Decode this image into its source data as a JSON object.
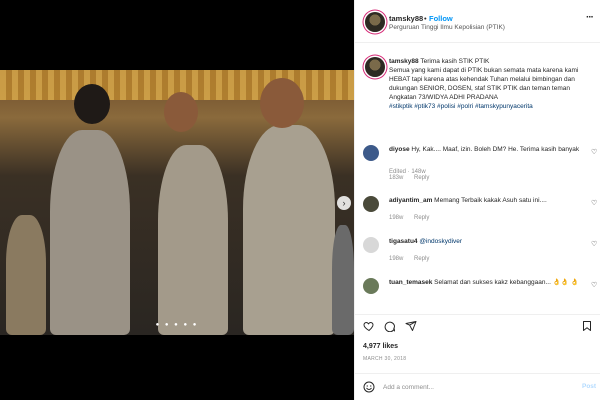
{
  "post": {
    "username": "tamsky88",
    "follow_label": "Follow",
    "dot": "•",
    "location": "Perguruan Tinggi Ilmu Kepolisian (PTIK)",
    "more_label": "···"
  },
  "caption": {
    "username": "tamsky88",
    "text": "Terima kasih STIK PTIK",
    "body": "Semua yang kami dapat di PTIK bukan semata mata karena kami HEBAT tapi karena atas kehendak Tuhan melalui bimbingan dan dukungan SENIOR, DOSEN, staf STIK PTIK dan teman teman Angkatan 73/WIDYA ADHI PRADANA",
    "hashtags": "#stikptik #ptik73 #polisi #polri #tamskypunyacerita",
    "edited": "Edited · 148w"
  },
  "comments": [
    {
      "username": "diyose",
      "text": "Hy, Kak.... Maaf, izin. Boleh DM? He. Terima kasih banyak",
      "age": "183w",
      "reply": "Reply",
      "avatar_color": "#3d5a8a"
    },
    {
      "username": "adiyantim_am",
      "text": "Memang Terbaik kakak Asuh satu ini....",
      "age": "198w",
      "reply": "Reply",
      "avatar_color": "#4a4a3a"
    },
    {
      "username": "tigasatu4",
      "text": "@indoskydiver",
      "age": "198w",
      "reply": "Reply",
      "avatar_color": "#d8d8d8"
    },
    {
      "username": "tuan_temasek",
      "text": "Selamat dan sukses kakz kebanggaan...  👌👌 👌",
      "age": "198w",
      "reply": "Reply",
      "avatar_color": "#6a7a5a"
    }
  ],
  "stats": {
    "likes": "4,977 likes",
    "date": "MARCH 30, 2018"
  },
  "add_comment": {
    "placeholder": "Add a comment...",
    "post_label": "Post"
  },
  "media": {
    "carousel_dots": "● ● ● ● ●",
    "next_arrow": "›"
  }
}
